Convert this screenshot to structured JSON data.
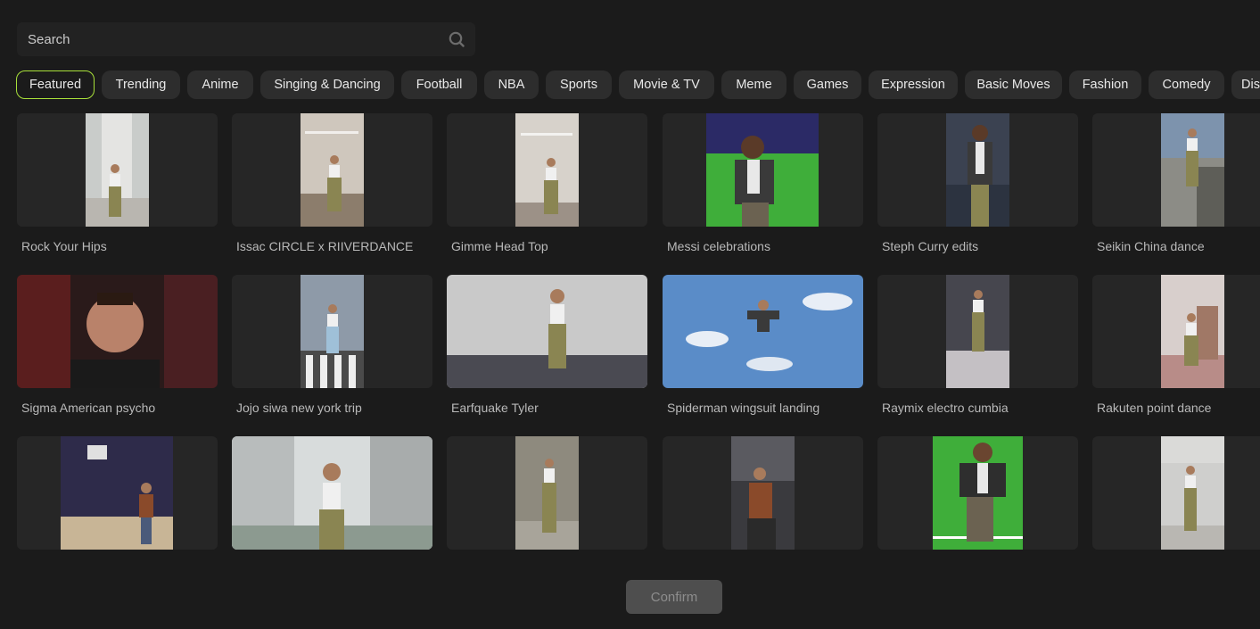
{
  "search": {
    "placeholder": "Search"
  },
  "tabs": [
    "Featured",
    "Trending",
    "Anime",
    "Singing & Dancing",
    "Football",
    "NBA",
    "Sports",
    "Movie & TV",
    "Meme",
    "Games",
    "Expression",
    "Basic Moves",
    "Fashion",
    "Comedy",
    "Dis"
  ],
  "active_tab": "Featured",
  "cards": [
    {
      "label": "Rock Your Hips",
      "scene": "hallway"
    },
    {
      "label": "Issac CIRCLE x RIIVERDANCE",
      "scene": "room"
    },
    {
      "label": "Gimme Head Top",
      "scene": "room"
    },
    {
      "label": "Messi celebrations",
      "scene": "stadium"
    },
    {
      "label": "Steph Curry edits",
      "scene": "crowd"
    },
    {
      "label": "Seikin China dance",
      "scene": "balcony"
    },
    {
      "label": "Sigma American psycho",
      "scene": "portrait"
    },
    {
      "label": "Jojo siwa new york trip",
      "scene": "street"
    },
    {
      "label": "Earfquake Tyler",
      "scene": "stage"
    },
    {
      "label": "Spiderman wingsuit landing",
      "scene": "sky"
    },
    {
      "label": "Raymix electro cumbia",
      "scene": "hall"
    },
    {
      "label": "Rakuten point dance",
      "scene": "bedroom"
    },
    {
      "label": "",
      "scene": "court"
    },
    {
      "label": "",
      "scene": "glass"
    },
    {
      "label": "",
      "scene": "outdoor"
    },
    {
      "label": "",
      "scene": "crowd"
    },
    {
      "label": "",
      "scene": "stadium"
    },
    {
      "label": "",
      "scene": "hallway"
    }
  ],
  "confirm_label": "Confirm",
  "colors": {
    "accent": "#a8e03a",
    "background": "#1b1b1b",
    "card": "#262626",
    "chip": "#2d2d2d"
  }
}
